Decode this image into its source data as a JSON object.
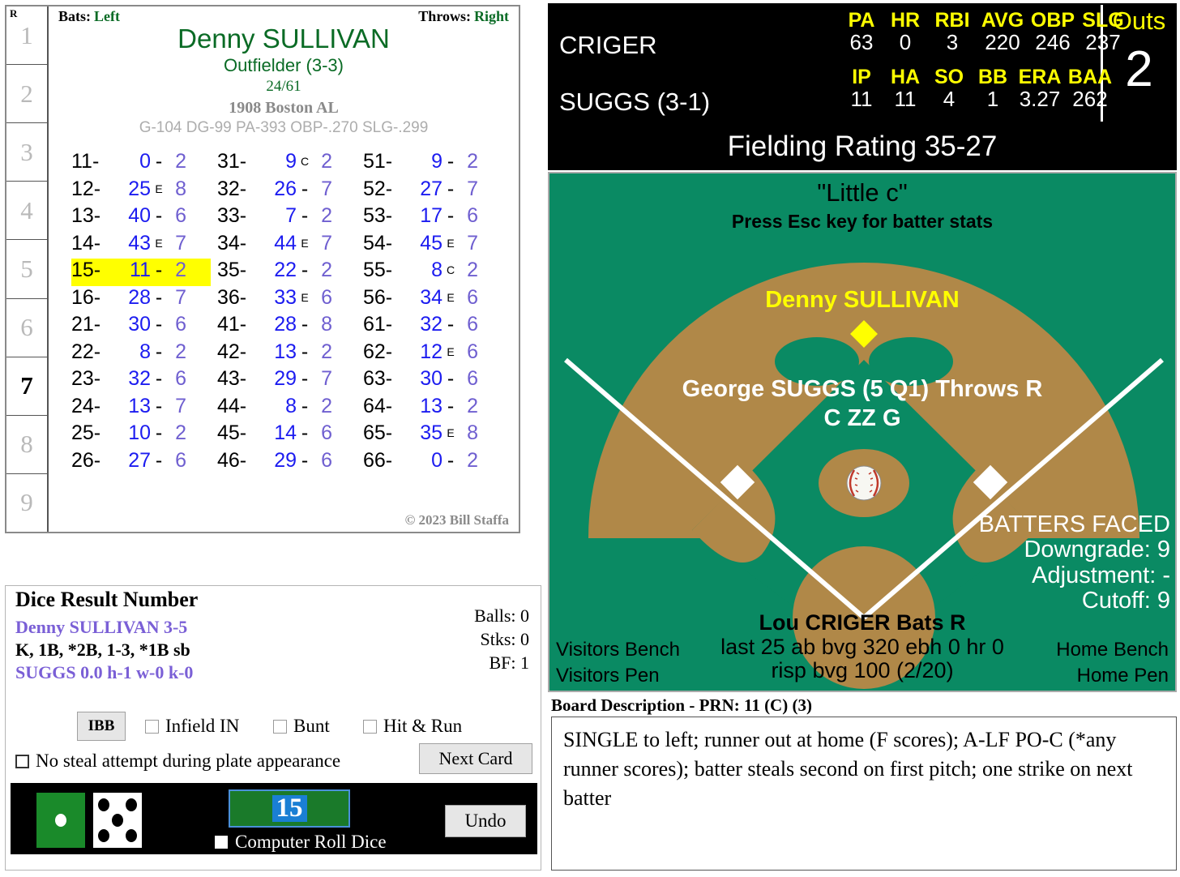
{
  "batter_card": {
    "inning_header": "R",
    "innings": [
      "1",
      "2",
      "3",
      "4",
      "5",
      "6",
      "7",
      "8",
      "9"
    ],
    "current_inning": "7",
    "bats_label": "Bats:",
    "bats_value": "Left",
    "throws_label": "Throws:",
    "throws_value": "Right",
    "name": "Denny SULLIVAN",
    "position": "Outfielder (3-3)",
    "number": "24/61",
    "team": "1908 Boston AL",
    "stats_line": "G-104 DG-99 PA-393 OBP-.270 SLG-.299",
    "copyright": "© 2023 Bill Staffa",
    "highlighted_roll": "15",
    "rolls": [
      {
        "key": "11-",
        "result": "0",
        "sep": "-",
        "fielder": "2"
      },
      {
        "key": "12-",
        "result": "25",
        "sep": "E",
        "fielder": "8"
      },
      {
        "key": "13-",
        "result": "40",
        "sep": "-",
        "fielder": "6"
      },
      {
        "key": "14-",
        "result": "43",
        "sep": "E",
        "fielder": "7"
      },
      {
        "key": "15-",
        "result": "11",
        "sep": "-",
        "fielder": "2"
      },
      {
        "key": "16-",
        "result": "28",
        "sep": "-",
        "fielder": "7"
      },
      {
        "key": "21-",
        "result": "30",
        "sep": "-",
        "fielder": "6"
      },
      {
        "key": "22-",
        "result": "8",
        "sep": "-",
        "fielder": "2"
      },
      {
        "key": "23-",
        "result": "32",
        "sep": "-",
        "fielder": "6"
      },
      {
        "key": "24-",
        "result": "13",
        "sep": "-",
        "fielder": "7"
      },
      {
        "key": "25-",
        "result": "10",
        "sep": "-",
        "fielder": "2"
      },
      {
        "key": "26-",
        "result": "27",
        "sep": "-",
        "fielder": "6"
      },
      {
        "key": "31-",
        "result": "9",
        "sep": "C",
        "fielder": "2"
      },
      {
        "key": "32-",
        "result": "26",
        "sep": "-",
        "fielder": "7"
      },
      {
        "key": "33-",
        "result": "7",
        "sep": "-",
        "fielder": "2"
      },
      {
        "key": "34-",
        "result": "44",
        "sep": "E",
        "fielder": "7"
      },
      {
        "key": "35-",
        "result": "22",
        "sep": "-",
        "fielder": "2"
      },
      {
        "key": "36-",
        "result": "33",
        "sep": "E",
        "fielder": "6"
      },
      {
        "key": "41-",
        "result": "28",
        "sep": "-",
        "fielder": "8"
      },
      {
        "key": "42-",
        "result": "13",
        "sep": "-",
        "fielder": "2"
      },
      {
        "key": "43-",
        "result": "29",
        "sep": "-",
        "fielder": "7"
      },
      {
        "key": "44-",
        "result": "8",
        "sep": "-",
        "fielder": "2"
      },
      {
        "key": "45-",
        "result": "14",
        "sep": "-",
        "fielder": "6"
      },
      {
        "key": "46-",
        "result": "29",
        "sep": "-",
        "fielder": "6"
      },
      {
        "key": "51-",
        "result": "9",
        "sep": "-",
        "fielder": "2"
      },
      {
        "key": "52-",
        "result": "27",
        "sep": "-",
        "fielder": "7"
      },
      {
        "key": "53-",
        "result": "17",
        "sep": "-",
        "fielder": "6"
      },
      {
        "key": "54-",
        "result": "45",
        "sep": "E",
        "fielder": "7"
      },
      {
        "key": "55-",
        "result": "8",
        "sep": "C",
        "fielder": "2"
      },
      {
        "key": "56-",
        "result": "34",
        "sep": "E",
        "fielder": "6"
      },
      {
        "key": "61-",
        "result": "32",
        "sep": "-",
        "fielder": "6"
      },
      {
        "key": "62-",
        "result": "12",
        "sep": "E",
        "fielder": "6"
      },
      {
        "key": "63-",
        "result": "30",
        "sep": "-",
        "fielder": "6"
      },
      {
        "key": "64-",
        "result": "13",
        "sep": "-",
        "fielder": "2"
      },
      {
        "key": "65-",
        "result": "35",
        "sep": "E",
        "fielder": "8"
      },
      {
        "key": "66-",
        "result": "0",
        "sep": "-",
        "fielder": "2"
      }
    ]
  },
  "dice_panel": {
    "title": "Dice Result Number",
    "batter_line": "Denny SULLIVAN  3-5",
    "result_line": "K, 1B, *2B, 1-3, *1B sb",
    "pitcher_line": "SUGGS  0.0  h-1  w-0  k-0",
    "balls_label": "Balls: 0",
    "strikes_label": "Stks: 0",
    "bf_label": "BF: 1",
    "ibb_label": "IBB",
    "infield_in_label": "Infield IN",
    "bunt_label": "Bunt",
    "hit_and_run_label": "Hit & Run",
    "no_steal_label": "No steal attempt during plate appearance",
    "next_card_label": "Next Card",
    "computer_roll_label": "Computer Roll Dice",
    "undo_label": "Undo",
    "dice_total": "15",
    "die_green_value": 1,
    "die_white_value": 5
  },
  "scoreboard": {
    "batter_name": "CRIGER",
    "batter_headers": [
      "PA",
      "HR",
      "RBI",
      "AVG",
      "OBP",
      "SLG"
    ],
    "batter_values": [
      "63",
      "0",
      "3",
      "220",
      "246",
      "237"
    ],
    "pitcher_name": "SUGGS (3-1)",
    "pitcher_headers": [
      "IP",
      "HA",
      "SO",
      "BB",
      "ERA",
      "BAA"
    ],
    "pitcher_values": [
      "11",
      "11",
      "4",
      "1",
      "3.27",
      "262"
    ],
    "outs_label": "Outs",
    "outs_value": "2"
  },
  "fielding": {
    "rating_text": "Fielding Rating 35-27"
  },
  "field": {
    "little_c": "\"Little c\"",
    "esc_hint": "Press Esc key for batter stats",
    "fielder_name": "Denny SULLIVAN",
    "pitcher_line1": "George SUGGS (5 Q1) Throws R",
    "pitcher_line2": "C ZZ G",
    "batters_faced_label": "BATTERS FACED",
    "downgrade": "Downgrade: 9",
    "adjustment": "Adjustment: -",
    "cutoff": "Cutoff: 9",
    "batter_name_line": "Lou CRIGER Bats R",
    "batter_last25": "last 25 ab bvg 320 ebh 0 hr 0",
    "batter_risp": "risp bvg 100 (2/20)",
    "visitors_bench": "Visitors Bench",
    "visitors_pen": "Visitors Pen",
    "home_bench": "Home Bench",
    "home_pen": "Home Pen"
  },
  "board_description": {
    "label": "Board Description - PRN: 11 (C) (3)",
    "text": "SINGLE to left; runner out at home (F scores); A-LF PO-C (*any runner scores); batter steals second on first pitch; one strike on next batter"
  },
  "colors": {
    "field_green": "#0a8a63",
    "dirt_brown": "#b08848",
    "accent_yellow": "#ffff00",
    "card_green": "#0a6b25",
    "roll_blue": "#1c1cf0",
    "fielder_purple": "#6f5fd0",
    "highlight": "#ffff00"
  }
}
